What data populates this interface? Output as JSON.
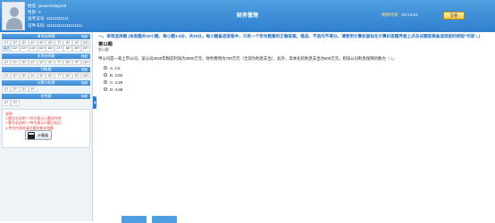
{
  "header": {
    "name_label": "姓名:",
    "name_value": "jiaoweizdagc48",
    "id_label": "性别:",
    "id_value": "X",
    "ticket_label": "准考证号:",
    "ticket_value": "11111111111",
    "cert_label": "证件号码:",
    "cert_value": "111111111111111111",
    "title": "财务管理",
    "timer_label": "剩余时间:",
    "timer_value": "03:14:53",
    "submit_label": "交卷"
  },
  "sidebar": {
    "sections": [
      {
        "title": "单项选择题",
        "back": "隐藏",
        "count": 20,
        "current": 11
      },
      {
        "title": "多项选择题",
        "back": "隐藏",
        "count": 10
      },
      {
        "title": "判断题",
        "back": "隐藏",
        "count": 10
      },
      {
        "title": "计算分析题",
        "back": "隐藏",
        "count": 4
      },
      {
        "title": "综合题",
        "back": "隐藏",
        "count": 2
      }
    ],
    "tips": [
      "说明:",
      "1.题号右边的\"?\"符号表示小题未作答",
      "2.题号右边的\"√\"符号表示小题已标记",
      "3.考生作答时请注意检查未答题"
    ],
    "calculator_label": "计算器"
  },
  "main": {
    "instructions": "一、单项选择题 (本类题共20小题，每小题1.5分，共30分。每小题备选答案中，只有一个符合题意的正确答案。错选、不选均不得分。请使用计算机鼠标在计算机答题界面上点击试题答案备选项前的按钮\"作答\"。)",
    "question_number": "第11题",
    "question_sub": "第11题",
    "stem": "甲公司是一家上市公司，该公司2020年税前利润为3000万元，财务费用为700万元（全部为利息支出），此外，资本化的利息支出为500万元。则该公司利息保障倍数为（ ）。",
    "options": [
      {
        "letter": "A.",
        "text": "2.5"
      },
      {
        "letter": "B.",
        "text": "3.08"
      },
      {
        "letter": "C.",
        "text": "4.29"
      },
      {
        "letter": "D.",
        "text": "4.88"
      }
    ]
  }
}
